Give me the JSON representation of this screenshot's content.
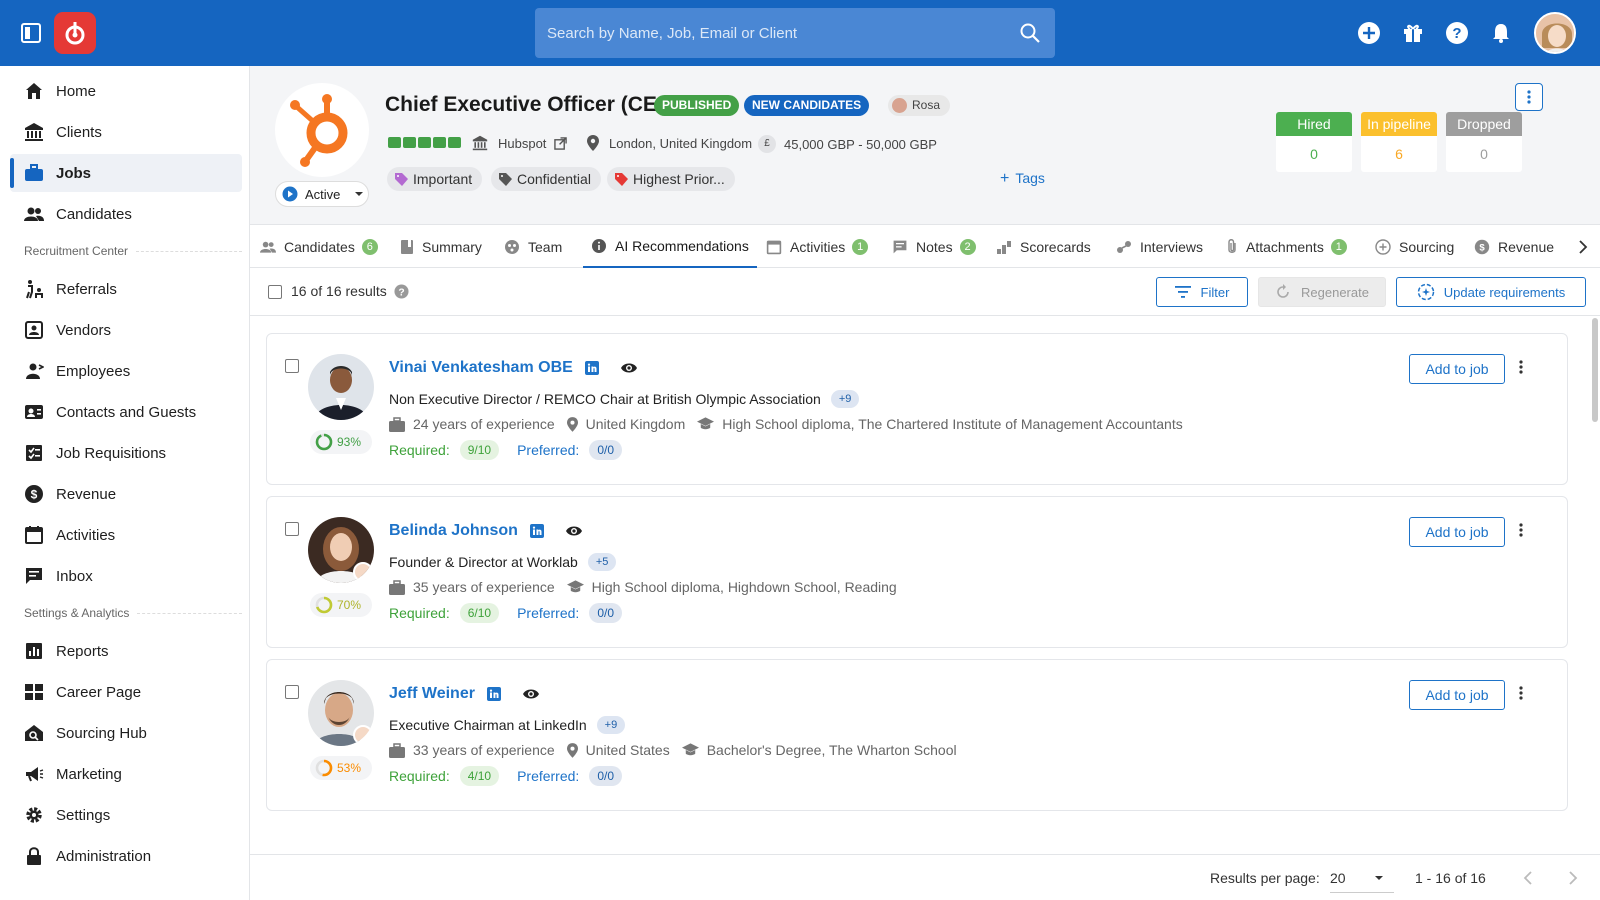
{
  "app": {
    "search_placeholder": "Search by Name, Job, Email or Client",
    "brand_color": "#1565c0",
    "logo_color": "#e53935"
  },
  "sidebar": {
    "items": [
      {
        "label": "Home",
        "icon": "home-icon"
      },
      {
        "label": "Clients",
        "icon": "bank-icon"
      },
      {
        "label": "Jobs",
        "icon": "briefcase-icon",
        "active": true
      },
      {
        "label": "Candidates",
        "icon": "people-icon"
      }
    ],
    "section_recruitment": "Recruitment Center",
    "recruitment_items": [
      {
        "label": "Referrals",
        "icon": "referral-icon"
      },
      {
        "label": "Vendors",
        "icon": "vendor-icon"
      },
      {
        "label": "Employees",
        "icon": "employee-icon"
      },
      {
        "label": "Contacts and Guests",
        "icon": "contacts-icon"
      },
      {
        "label": "Job Requisitions",
        "icon": "requisition-icon"
      },
      {
        "label": "Revenue",
        "icon": "dollar-icon"
      },
      {
        "label": "Activities",
        "icon": "calendar-icon"
      },
      {
        "label": "Inbox",
        "icon": "inbox-icon"
      }
    ],
    "section_settings": "Settings & Analytics",
    "settings_items": [
      {
        "label": "Reports",
        "icon": "reports-icon"
      },
      {
        "label": "Career Page",
        "icon": "career-icon"
      },
      {
        "label": "Sourcing Hub",
        "icon": "sourcing-hub-icon"
      },
      {
        "label": "Marketing",
        "icon": "megaphone-icon"
      },
      {
        "label": "Settings",
        "icon": "gear-icon"
      },
      {
        "label": "Administration",
        "icon": "lock-icon"
      }
    ]
  },
  "job": {
    "title": "Chief Executive Officer (CEO)",
    "badge_published": "PUBLISHED",
    "badge_new": "NEW CANDIDATES",
    "owner": "Rosa",
    "status": "Active",
    "company": "Hubspot",
    "location": "London, United Kingdom",
    "currency_symbol": "£",
    "salary": "45,000 GBP - 50,000 GBP",
    "tags": [
      "Important",
      "Confidential",
      "Highest Prior..."
    ],
    "tag_colors": [
      "#b36ad1",
      "#555555",
      "#e53935"
    ],
    "add_tags": "Tags",
    "pipeline": {
      "hired_label": "Hired",
      "hired_value": "0",
      "pipeline_label": "In pipeline",
      "pipeline_value": "6",
      "dropped_label": "Dropped",
      "dropped_value": "0"
    },
    "colors": {
      "published": "#43a047",
      "new": "#1565c0",
      "hired": "#4caf50",
      "pipeline": "#fbc02d",
      "dropped": "#9e9e9e"
    }
  },
  "tabs": [
    {
      "label": "Candidates",
      "count": "6"
    },
    {
      "label": "Summary"
    },
    {
      "label": "Team"
    },
    {
      "label": "AI Recommendations",
      "active": true
    },
    {
      "label": "Activities",
      "count": "1"
    },
    {
      "label": "Notes",
      "count": "2"
    },
    {
      "label": "Scorecards"
    },
    {
      "label": "Interviews"
    },
    {
      "label": "Attachments",
      "count": "1"
    },
    {
      "label": "Sourcing"
    },
    {
      "label": "Revenue"
    }
  ],
  "toolbar": {
    "results": "16 of 16 results",
    "filter": "Filter",
    "regenerate": "Regenerate",
    "update": "Update requirements"
  },
  "candidates": [
    {
      "name": "Vinai Venkatesham OBE",
      "headline": "Non Executive Director / REMCO Chair at British Olympic Association",
      "more": "+9",
      "experience": "24 years of experience",
      "location": "United Kingdom",
      "education": "High School diploma, The Chartered Institute of Management Accountants",
      "match": "93%",
      "match_value": 0.93,
      "match_color": "#43a047",
      "required_label": "Required:",
      "required": "9/10",
      "preferred_label": "Preferred:",
      "preferred": "0/0",
      "add": "Add to job"
    },
    {
      "name": "Belinda Johnson",
      "headline": "Founder & Director at Worklab",
      "more": "+5",
      "experience": "35 years of experience",
      "education": "High School diploma, Highdown School, Reading",
      "match": "70%",
      "match_value": 0.7,
      "match_color": "#c0ca33",
      "required_label": "Required:",
      "required": "6/10",
      "preferred_label": "Preferred:",
      "preferred": "0/0",
      "add": "Add to job"
    },
    {
      "name": "Jeff Weiner",
      "headline": "Executive Chairman at LinkedIn",
      "more": "+9",
      "experience": "33 years of experience",
      "location": "United States",
      "education": "Bachelor's Degree, The Wharton School",
      "match": "53%",
      "match_value": 0.53,
      "match_color": "#fb8c00",
      "required_label": "Required:",
      "required": "4/10",
      "preferred_label": "Preferred:",
      "preferred": "0/0",
      "add": "Add to job"
    }
  ],
  "pagination": {
    "per_page_label": "Results per page:",
    "per_page": "20",
    "range": "1 - 16 of 16"
  }
}
